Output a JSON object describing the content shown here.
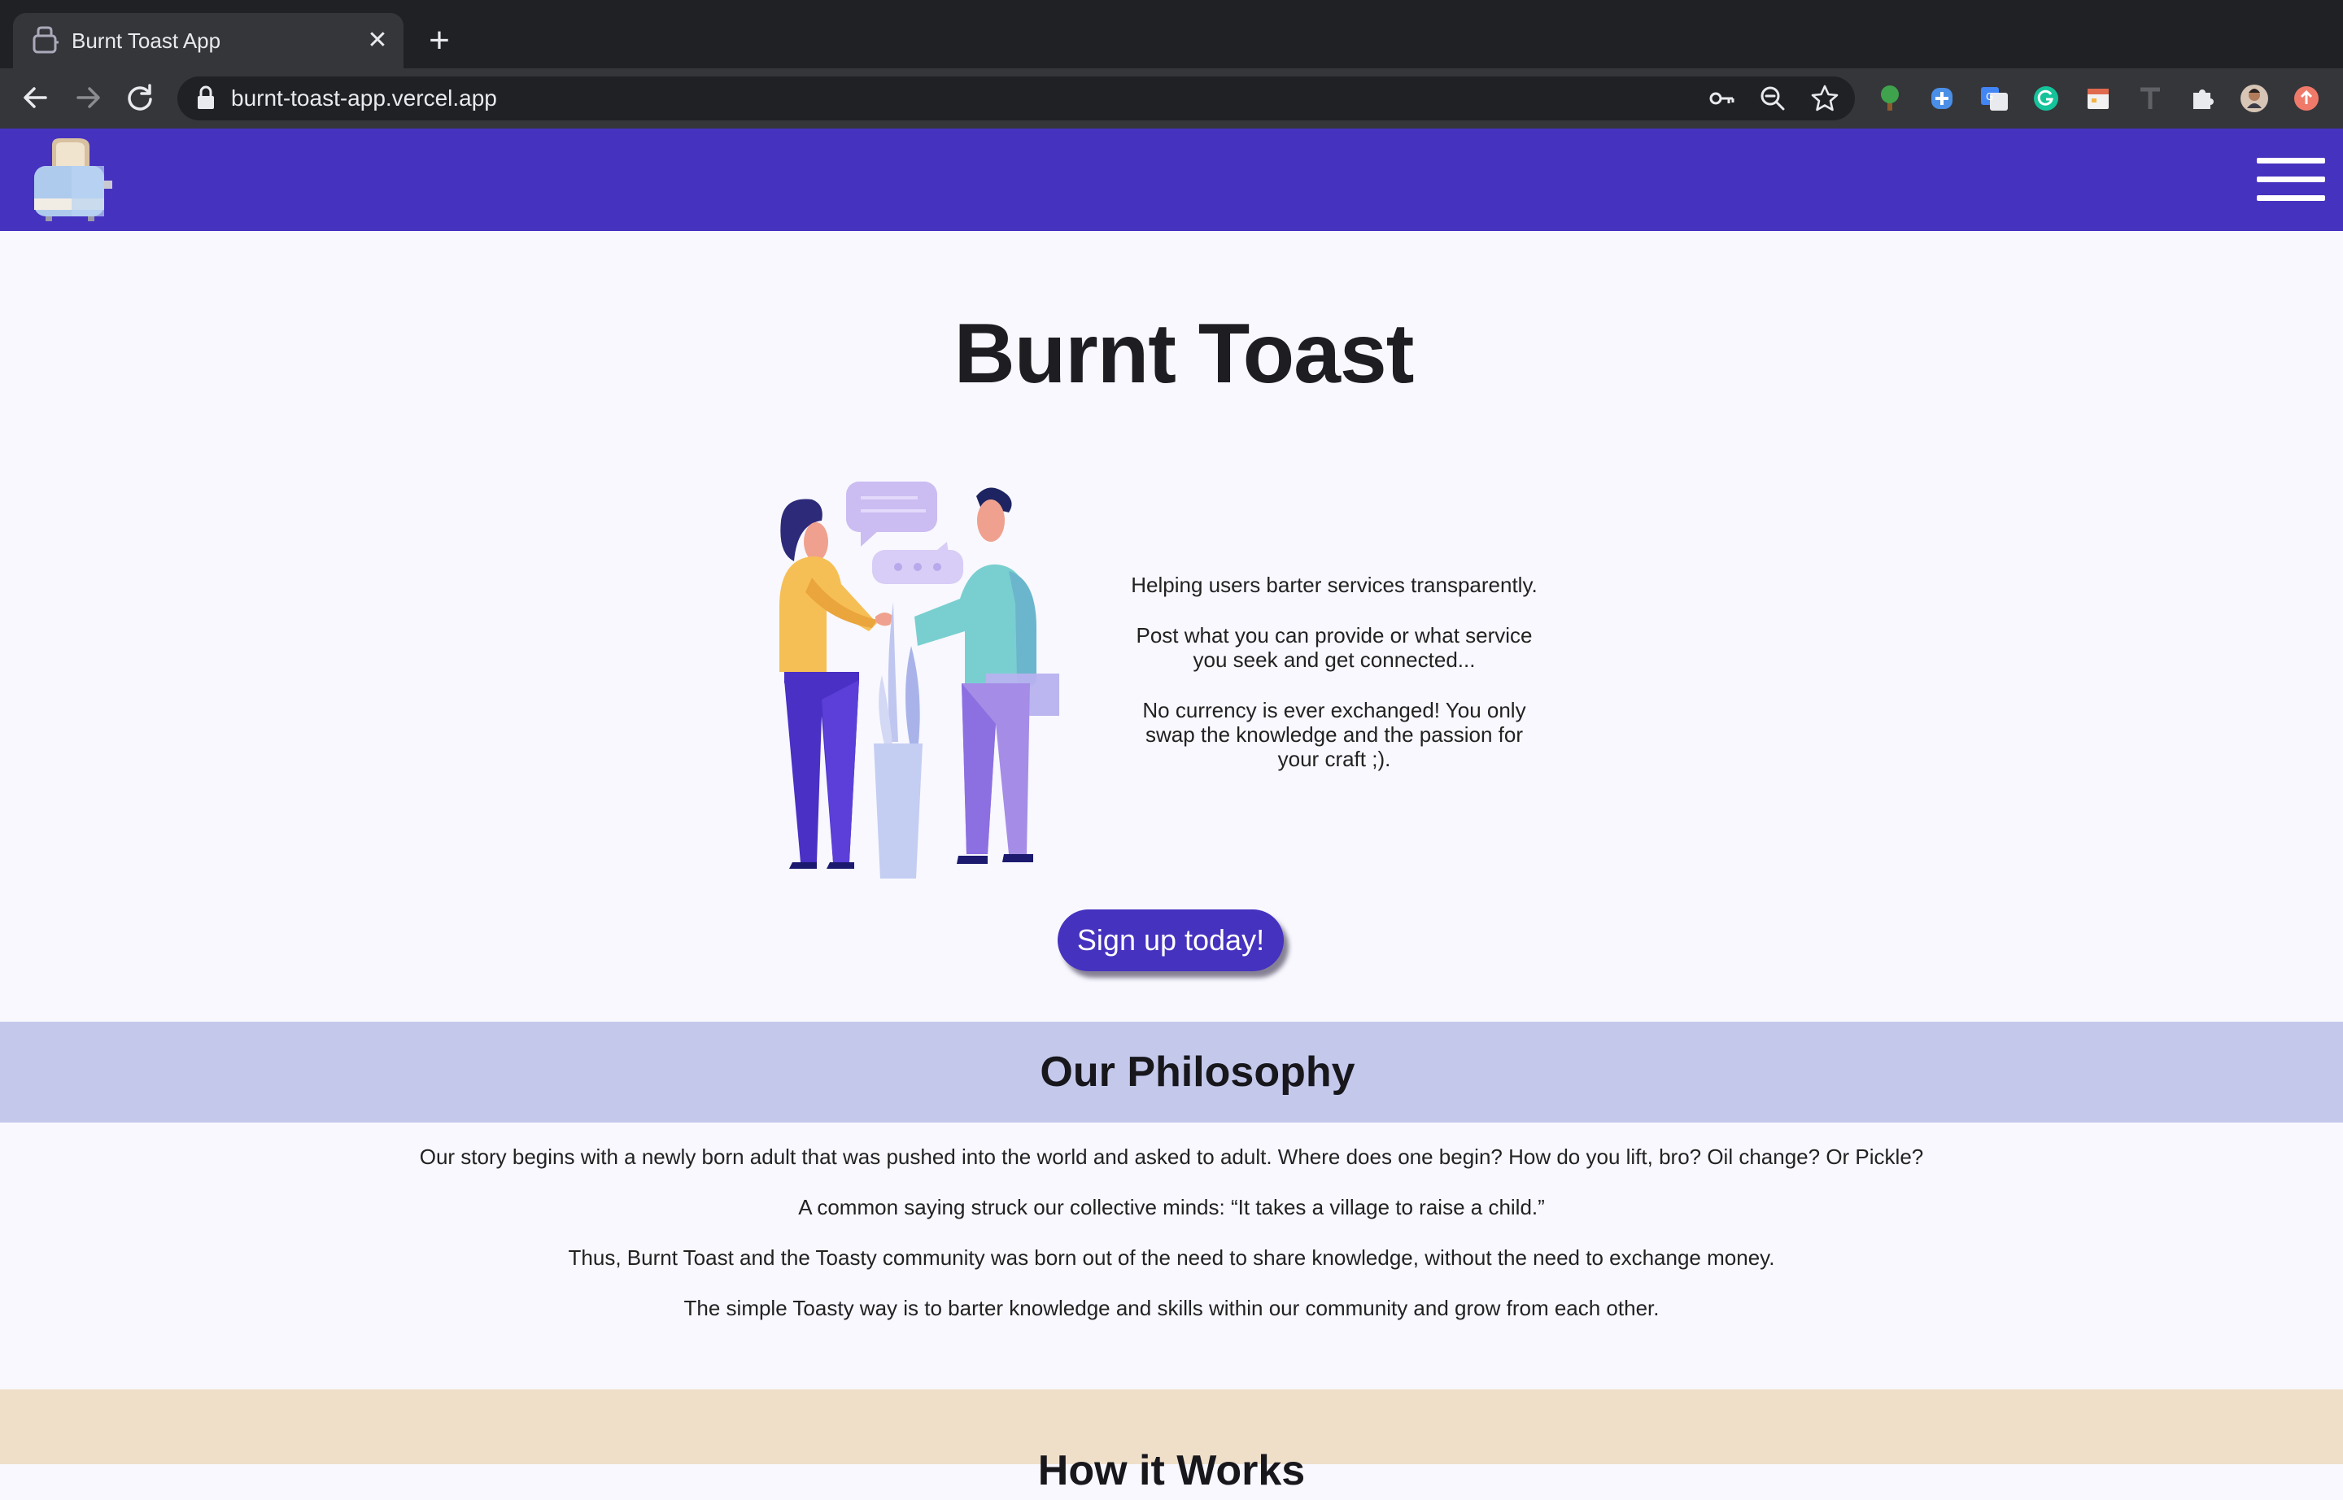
{
  "browser": {
    "tab_title": "Burnt Toast App",
    "tab_close": "✕",
    "new_tab": "+",
    "url": "burnt-toast-app.vercel.app",
    "chrome_color": "#202124",
    "toolbar_color": "#35363a"
  },
  "app": {
    "brand_color": "#4532bf",
    "logo": "toaster-icon",
    "menu_icon": "hamburger-icon"
  },
  "hero": {
    "title": "Burnt Toast",
    "paragraphs": [
      "Helping users barter services transparently.",
      "Post what you can provide or what service you seek and get connected...",
      "No currency is ever exchanged! You only swap the knowledge and the passion for your craft ;)."
    ],
    "cta": "Sign up today!",
    "illustration": "two-people-handshake-illustration"
  },
  "philosophy": {
    "title": "Our Philosophy",
    "band_color": "#c4c9ec",
    "paragraphs": [
      "Our story begins with a newly born adult that was pushed into the world and asked to adult. Where does one begin? How do you lift, bro? Oil change? Or Pickle?",
      "A common saying struck our collective minds: “It takes a village to raise a child.”",
      "Thus, Burnt Toast and the Toasty community was born out of the need to share knowledge, without the need to exchange money.",
      "The simple Toasty way is to barter knowledge and skills within our community and grow from each other."
    ]
  },
  "next_section": {
    "title": "How it Works",
    "band_color": "#efdfc9"
  }
}
